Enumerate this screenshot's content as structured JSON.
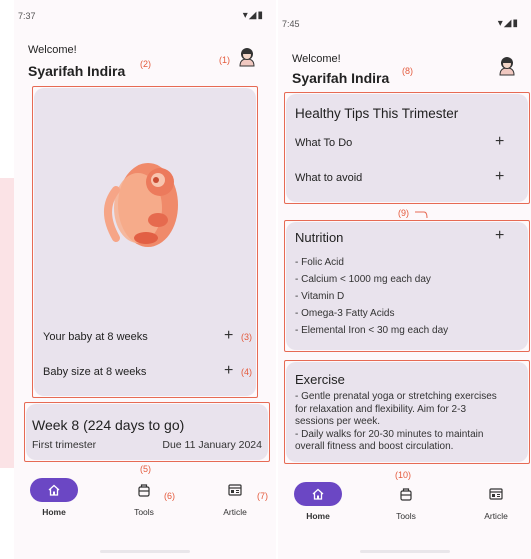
{
  "screen1": {
    "status_time": "7:37",
    "welcome": "Welcome!",
    "user_name": "Syarifah Indira",
    "fetus_rows": [
      {
        "label": "Your baby at 8 weeks"
      },
      {
        "label": "Baby size at 8 weeks"
      }
    ],
    "week_title": "Week 8 (224 days to go)",
    "trimester": "First trimester",
    "due": "Due 11 January 2024",
    "annotations": {
      "a1": "(1)",
      "a2": "(2)",
      "a3": "(3)",
      "a4": "(4)",
      "a5": "(5)",
      "a6": "(6)",
      "a7": "(7)"
    }
  },
  "screen2": {
    "status_time": "7:45",
    "welcome": "Welcome!",
    "user_name": "Syarifah Indira",
    "tips_title": "Healthy Tips This Trimester",
    "tips_rows": [
      {
        "label": "What To Do"
      },
      {
        "label": "What to avoid"
      }
    ],
    "nutrition_title": "Nutrition",
    "nutrition_items": [
      "- Folic Acid",
      "- Calcium < 1000 mg each day",
      "- Vitamin D",
      "- Omega-3 Fatty Acids",
      "- Elemental Iron < 30  mg each day"
    ],
    "exercise_title": "Exercise",
    "exercise_lines": [
      "- Gentle prenatal yoga or stretching exercises",
      "for relaxation and flexibility. Aim for 2-3",
      "sessions per week.",
      "- Daily walks for 20-30 minutes to maintain",
      "overall fitness and boost circulation."
    ],
    "annotations": {
      "a8": "(8)",
      "a9": "(9)",
      "a10": "(10)"
    }
  },
  "nav": {
    "items": [
      {
        "label": "Home",
        "icon": "home-icon",
        "active": true
      },
      {
        "label": "Tools",
        "icon": "tools-icon",
        "active": false
      },
      {
        "label": "Article",
        "icon": "article-icon",
        "active": false
      }
    ]
  },
  "colors": {
    "accent": "#6b47c4",
    "card": "#e9e3ed",
    "annotation": "#e45a3c",
    "pink_strip": "#fbe3e6"
  }
}
